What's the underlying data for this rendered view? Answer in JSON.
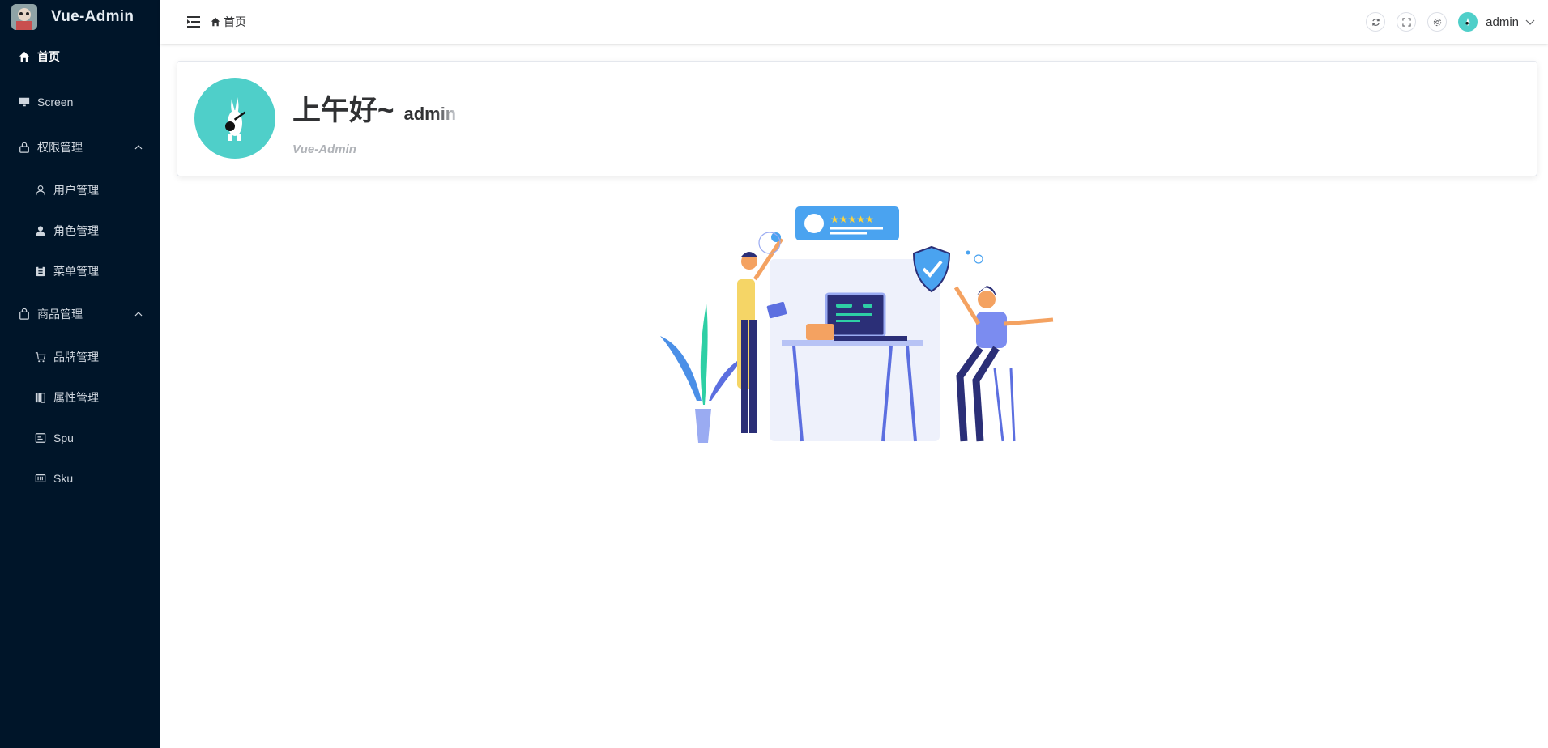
{
  "app": {
    "title": "Vue-Admin"
  },
  "sidebar": {
    "items": [
      {
        "label": "首页",
        "icon": "home-icon",
        "active": true
      },
      {
        "label": "Screen",
        "icon": "monitor-icon"
      },
      {
        "label": "权限管理",
        "icon": "lock-icon",
        "expanded": true,
        "children": [
          {
            "label": "用户管理",
            "icon": "user-icon"
          },
          {
            "label": "角色管理",
            "icon": "user-filled-icon"
          },
          {
            "label": "菜单管理",
            "icon": "clipboard-icon"
          }
        ]
      },
      {
        "label": "商品管理",
        "icon": "bag-icon",
        "expanded": true,
        "children": [
          {
            "label": "品牌管理",
            "icon": "cart-icon"
          },
          {
            "label": "属性管理",
            "icon": "books-icon"
          },
          {
            "label": "Spu",
            "icon": "calendar-icon"
          },
          {
            "label": "Sku",
            "icon": "tickets-icon"
          }
        ]
      }
    ]
  },
  "header": {
    "breadcrumb": "首页",
    "user": "admin"
  },
  "welcome": {
    "greeting": "上午好~",
    "name": "admin",
    "subtitle": "Vue-Admin"
  },
  "colors": {
    "sidebar_bg": "#001529",
    "accent": "#4fcfc9"
  }
}
